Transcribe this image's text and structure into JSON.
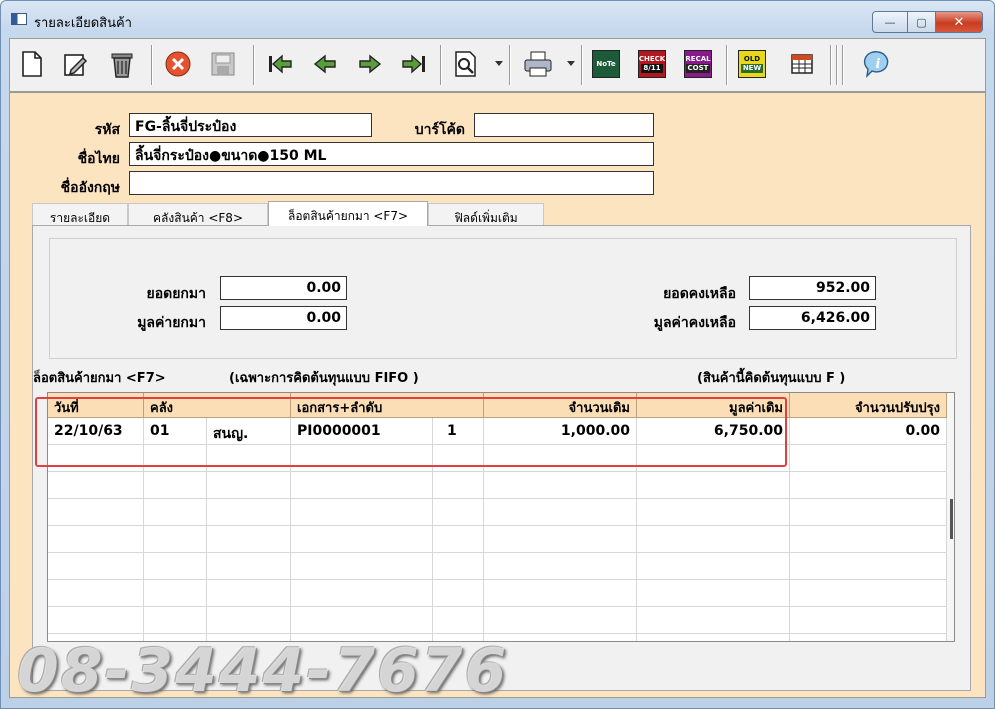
{
  "window": {
    "title": "รายละเอียดสินค้า",
    "minimize": "—",
    "maximize": "▢",
    "close": "✕"
  },
  "toolbar": {
    "icons": [
      "new-document-icon",
      "edit-icon",
      "trash-icon",
      "cancel-icon",
      "save-icon",
      "first-record-icon",
      "previous-record-icon",
      "next-record-icon",
      "last-record-icon",
      "search-icon",
      "print-icon",
      "note-icon",
      "check-icon",
      "recalc-cost-icon",
      "old-new-icon",
      "table-icon",
      "info-icon"
    ],
    "note_label": "NoTe",
    "check_label1": "CHECK",
    "check_label2": "8/11",
    "recal_label1": "RECAL",
    "recal_label2": "COST",
    "oldnew_label1": "OLD",
    "oldnew_label2": "NEW",
    "info_glyph": "i"
  },
  "form": {
    "code_label": "รหัส",
    "code_value": "FG-ลิ้นจี่ประป๋อง",
    "barcode_label": "บาร์โค้ด",
    "barcode_value": "",
    "thai_name_label": "ชื่อไทย",
    "thai_name_value": "ลิ้นจี่กระป๋อง●ขนาด●150 ML",
    "english_name_label": "ชื่ออังกฤษ",
    "english_name_value": ""
  },
  "tabs": [
    {
      "label": "รายละเอียด"
    },
    {
      "label": "คลังสินค้า <F8>"
    },
    {
      "label": "ล็อตสินค้ายกมา <F7>"
    },
    {
      "label": "ฟิลด์เพิ่มเติม"
    }
  ],
  "summary": {
    "opening_qty_label": "ยอดยกมา",
    "opening_qty": "0.00",
    "opening_value_label": "มูลค่ายกมา",
    "opening_value": "0.00",
    "balance_qty_label": "ยอดคงเหลือ",
    "balance_qty": "952.00",
    "balance_value_label": "มูลค่าคงเหลือ",
    "balance_value": "6,426.00"
  },
  "lot_section": {
    "title": "ล็อตสินค้ายกมา  <F7>",
    "note": "(เฉพาะการคิดต้นทุนแบบ FIFO )",
    "cost_method_note": "(สินค้านี้คิดต้นทุนแบบ   F   )"
  },
  "grid": {
    "headers": [
      "วันที่",
      "คลัง",
      "เอกสาร+ลำดับ",
      "จำนวนเดิม",
      "มูลค่าเดิม",
      "จำนวนปรับปรุง"
    ],
    "rows": [
      {
        "date": "22/10/63",
        "warehouse_code": "01",
        "warehouse_name": "สนญ.",
        "document": "PI0000001",
        "seq": "1",
        "qty": "1,000.00",
        "value": "6,750.00",
        "adjust_qty": "0.00"
      }
    ]
  },
  "watermark": "08-3444-7676",
  "colors": {
    "highlight": "#e24040",
    "header_bg": "#fbddb6",
    "client_bg": "#fde4c0"
  }
}
